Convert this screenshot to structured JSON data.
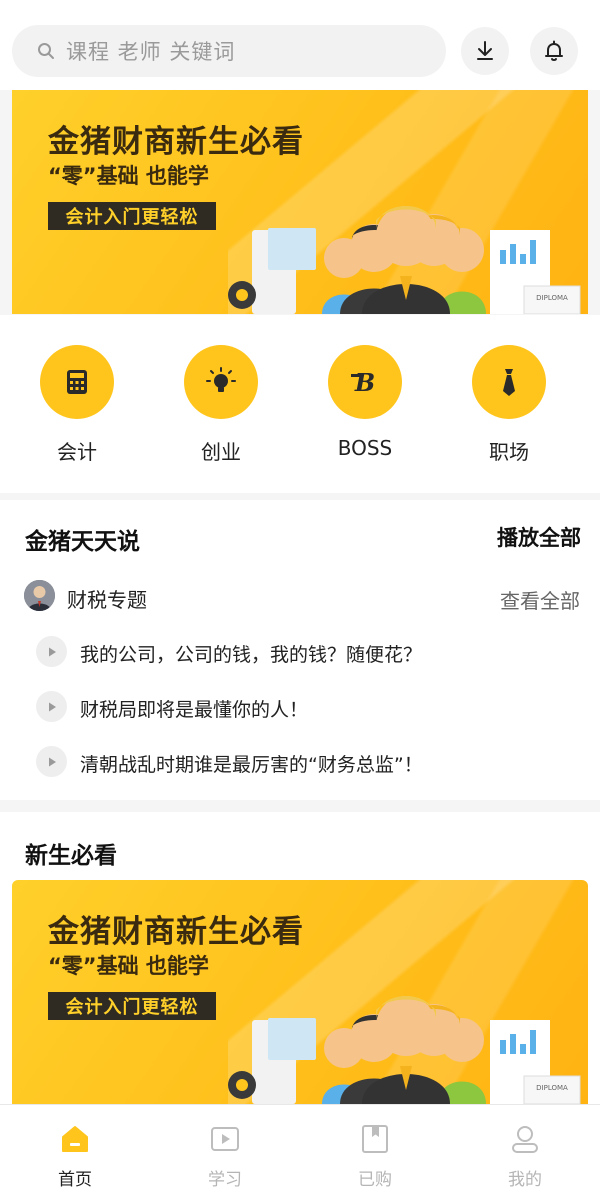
{
  "search": {
    "placeholder": "课程  老师  关键词"
  },
  "banner": {
    "title": "金猪财商新生必看",
    "subtitle": "“零”基础 也能学",
    "tag": "会计入门更轻松",
    "diploma": "DIPLOMA"
  },
  "categories": [
    {
      "label": "会计",
      "icon": "calculator-icon"
    },
    {
      "label": "创业",
      "icon": "lightbulb-icon"
    },
    {
      "label": "BOSS",
      "icon": "boss-b-icon"
    },
    {
      "label": "职场",
      "icon": "necktie-icon"
    }
  ],
  "talk": {
    "title": "金猪天天说",
    "play_all": "播放全部",
    "topic": {
      "name": "财税专题",
      "more": "查看全部"
    },
    "items": [
      "我的公司，公司的钱，我的钱？随便花？",
      "财税局即将是最懂你的人！",
      "清朝战乱时期谁是最厉害的“财务总监”！"
    ]
  },
  "new_section": {
    "title": "新生必看"
  },
  "nav": [
    {
      "label": "首页",
      "icon": "home-icon",
      "active": true
    },
    {
      "label": "学习",
      "icon": "video-icon",
      "active": false
    },
    {
      "label": "已购",
      "icon": "bookmark-icon",
      "active": false
    },
    {
      "label": "我的",
      "icon": "user-icon",
      "active": false
    }
  ],
  "colors": {
    "accent": "#ffc51c",
    "banner_dark": "#2f2a22"
  }
}
